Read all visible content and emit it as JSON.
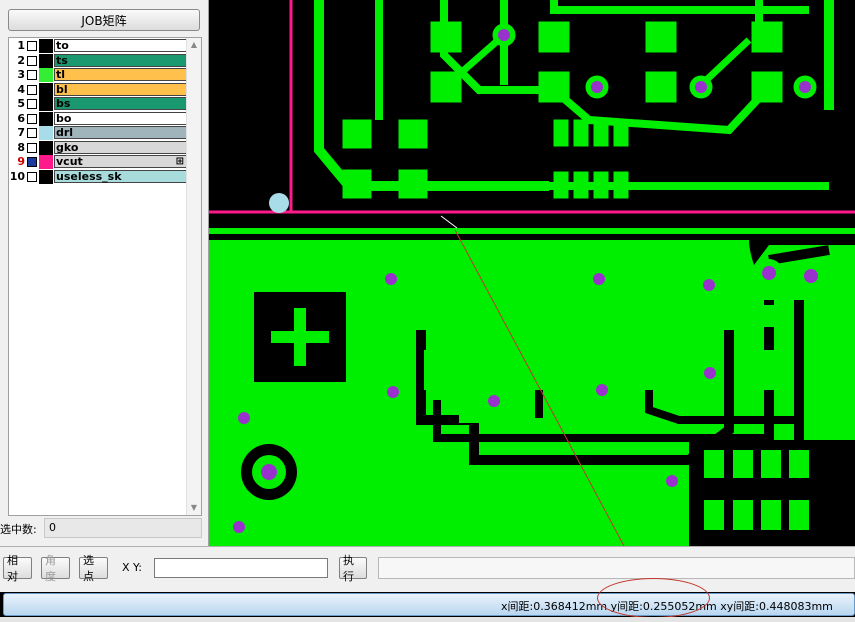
{
  "left_panel": {
    "job_button": "JOB矩阵",
    "layers": [
      {
        "num": "1",
        "name": "to",
        "color": "#ffffff",
        "swatch": "#000000",
        "checked": false
      },
      {
        "num": "2",
        "name": "ts",
        "color": "#1a9970",
        "swatch": "#000000",
        "checked": false
      },
      {
        "num": "3",
        "name": "tl",
        "color": "#ffc04c",
        "swatch": "#33ee33",
        "checked": false
      },
      {
        "num": "4",
        "name": "bl",
        "color": "#ffc04c",
        "swatch": "#000000",
        "checked": false
      },
      {
        "num": "5",
        "name": "bs",
        "color": "#1a9970",
        "swatch": "#000000",
        "checked": false
      },
      {
        "num": "6",
        "name": "bo",
        "color": "#ffffff",
        "swatch": "#000000",
        "checked": false
      },
      {
        "num": "7",
        "name": "drl",
        "color": "#a0b4bc",
        "swatch": "#a8dce8",
        "checked": false
      },
      {
        "num": "8",
        "name": "gko",
        "color": "#d8d8d8",
        "swatch": "#000000",
        "checked": false
      },
      {
        "num": "9",
        "name": "vcut",
        "color": "#d8d8d8",
        "swatch": "#ff1a8c",
        "checked": true
      },
      {
        "num": "10",
        "name": "useless_sk",
        "color": "#a8dcdc",
        "swatch": "#000000",
        "checked": false
      }
    ],
    "layer_nine_marker": "⊞",
    "selected_count_label": "选中数:",
    "selected_count_value": "0"
  },
  "toolbar": {
    "relative_button": "相对",
    "angle_button": "角度",
    "select_point_button": "选点",
    "xy_label": "X Y:",
    "xy_value": "",
    "execute_button": "执行"
  },
  "status": {
    "measurement_text": "x间距:0.368412mm  y间距:0.255052mm  xy间距:0.448083mm"
  },
  "colors": {
    "copper": "#00ee00",
    "board": "#000000",
    "outline": "#ff1a8c",
    "pad": "#9932cc",
    "drill": "#a8dce8",
    "measure_line": "#c0392b"
  }
}
